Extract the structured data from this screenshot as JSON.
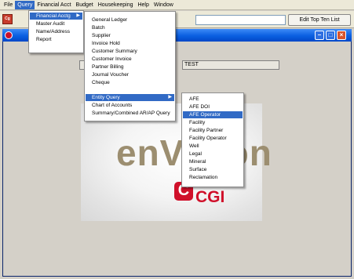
{
  "menubar": {
    "items": [
      {
        "label": "File"
      },
      {
        "label": "Query",
        "active": true
      },
      {
        "label": "Financial Acct"
      },
      {
        "label": "Budget"
      },
      {
        "label": "Housekeeping"
      },
      {
        "label": "Help"
      },
      {
        "label": "Window"
      }
    ]
  },
  "toolbar": {
    "app_icon_text": "Cg",
    "search_value": "",
    "edit_top_ten_label": "Edit Top Ten List"
  },
  "query_menu": {
    "items": [
      {
        "label": "Financial Acctg",
        "highlighted": true,
        "has_submenu": true
      },
      {
        "label": "Master Audit"
      },
      {
        "label": "Name/Address"
      },
      {
        "label": "Report"
      }
    ]
  },
  "financial_menu": {
    "items": [
      {
        "label": "General Ledger"
      },
      {
        "label": "Batch"
      },
      {
        "label": "Supplier"
      },
      {
        "label": "Invoice Hold"
      },
      {
        "label": "Customer Summary"
      },
      {
        "label": "Customer Invoice"
      },
      {
        "label": "Partner Billing"
      },
      {
        "label": "Journal Voucher"
      },
      {
        "label": "Cheque"
      },
      {
        "label": "Entity Query",
        "highlighted": true,
        "has_submenu": true
      },
      {
        "label": "Chart of Accounts"
      },
      {
        "label": "Summary/Combined AR/AP Query"
      }
    ]
  },
  "entity_menu": {
    "items": [
      {
        "label": "AFE"
      },
      {
        "label": "AFE DOI"
      },
      {
        "label": "AFE Operator",
        "highlighted": true
      },
      {
        "label": "Facility"
      },
      {
        "label": "Facility Partner"
      },
      {
        "label": "Facility Operator"
      },
      {
        "label": "Well"
      },
      {
        "label": "Legal"
      },
      {
        "label": "Mineral"
      },
      {
        "label": "Surface"
      },
      {
        "label": "Reclamation"
      }
    ]
  },
  "content": {
    "field_right_text": "TEST",
    "logo_text": "enVision",
    "cgi_mark": "C",
    "cgi_text": "CGI"
  },
  "window_buttons": {
    "minimize": "–",
    "maximize": "□",
    "close": "×"
  },
  "colors": {
    "highlight": "#316ac5",
    "cgi_red": "#d0102a",
    "title_blue": "#0a5fe0"
  }
}
